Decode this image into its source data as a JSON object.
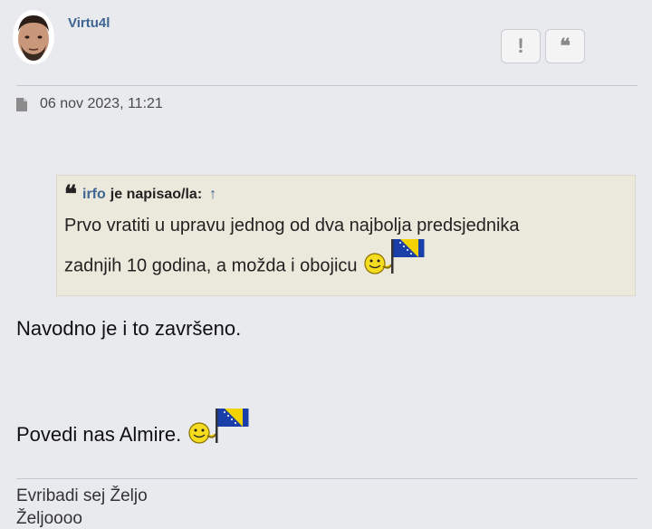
{
  "post": {
    "author": "Virtu4l",
    "date": "06 nov 2023, 11:21",
    "buttons": {
      "report_icon": "exclamation-icon",
      "report_glyph": "!",
      "quote_icon": "quote-icon",
      "quote_glyph": "❝"
    },
    "quote": {
      "author": "irfo",
      "wrote_label": "je napisao/la:",
      "arrow": "↑",
      "lines": [
        "Prvo vratiti u upravu jednog od dva najbolja predsjednika",
        "zadnjih 10 godina, a možda i obojicu"
      ]
    },
    "body": [
      "Navodno je i to završeno.",
      "Povedi nas Almire."
    ],
    "signature": [
      "Evribadi sej Željo",
      "Željoooo"
    ]
  },
  "colors": {
    "background": "#e8eaee",
    "username": "#3f6592",
    "quote_background": "#ebe9dc"
  }
}
